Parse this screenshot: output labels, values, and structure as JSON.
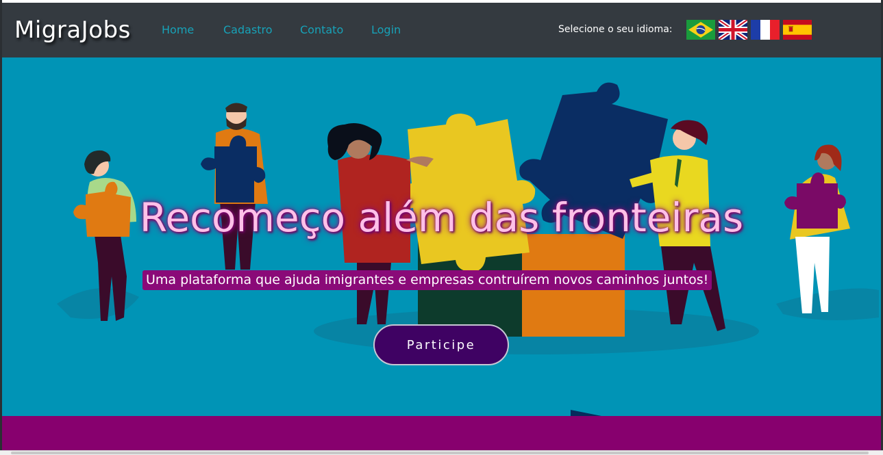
{
  "navbar": {
    "brand": "MigraJobs",
    "links": [
      {
        "label": "Home"
      },
      {
        "label": "Cadastro"
      },
      {
        "label": "Contato"
      },
      {
        "label": "Login"
      }
    ],
    "language_label": "Selecione o seu idioma:",
    "flags": [
      "brazil-flag-icon",
      "uk-flag-icon",
      "france-flag-icon",
      "spain-flag-icon"
    ]
  },
  "hero": {
    "title": "Recomeço além das fronteiras",
    "subtitle": "Uma plataforma que ajuda imigrantes e empresas contruírem novos caminhos juntos!",
    "cta_label": "Participe"
  },
  "colors": {
    "navbar_bg": "#343a40",
    "nav_link": "#17a2b8",
    "hero_bg": "#0094b6",
    "title_text": "#ffc0e8",
    "subtitle_bg": "#8a0a78",
    "cta_bg": "#3f0263",
    "footer_band": "#87006e"
  }
}
